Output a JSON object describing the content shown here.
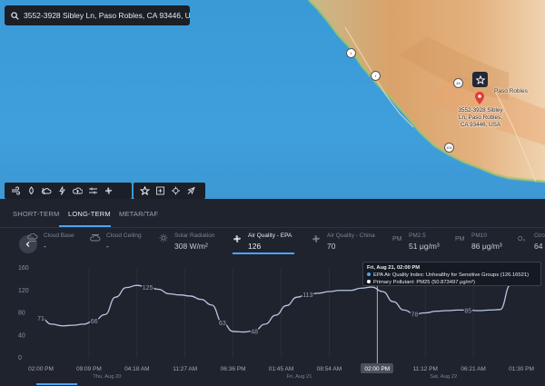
{
  "search": {
    "value": "3552-3928 Sibley Ln, Paso Robles, CA 93446, U"
  },
  "map": {
    "pin_label": "3552-3928 Sibley Ln, Paso Robles, CA 93446, USA",
    "pin_label_lines": [
      "3552-3928 Sibley",
      "Ln, Paso Robles,",
      "CA 93446, USA"
    ],
    "town_label": "Paso Robles",
    "highway_labels": [
      "1",
      "1",
      "46",
      "101"
    ]
  },
  "map_tools": {
    "group1": [
      "wind-icon",
      "rain-icon",
      "cloud-icon",
      "lightning-icon",
      "cloud-upload-icon",
      "sliders-icon",
      "fan-icon"
    ],
    "group2": [
      "star-icon",
      "plus-square-icon",
      "crosshair-icon",
      "plane-icon"
    ]
  },
  "tabs": [
    {
      "label": "SHORT-TERM",
      "active": false
    },
    {
      "label": "LONG-TERM",
      "active": true
    },
    {
      "label": "METAR/TAF",
      "active": false
    }
  ],
  "metrics": [
    {
      "name": "Cloud Base",
      "value": "-",
      "icon": "cloud-base-icon",
      "active": false
    },
    {
      "name": "Cloud Ceiling",
      "value": "-",
      "icon": "cloud-ceiling-icon",
      "active": false
    },
    {
      "name": "Solar Radiation",
      "value": "308 W/m²",
      "icon": "sun-icon",
      "active": false
    },
    {
      "name": "Air Quality - EPA",
      "value": "126",
      "icon": "fan-icon",
      "active": true
    },
    {
      "name": "Air Quality - China",
      "value": "70",
      "icon": "fan-icon",
      "active": false
    },
    {
      "name": "PM2.5",
      "value": "51 μg/m³",
      "icon": "pm25-icon",
      "active": false
    },
    {
      "name": "PM10",
      "value": "86 μg/m³",
      "icon": "pm10-icon",
      "active": false
    },
    {
      "name": "Ozo",
      "value": "64",
      "icon": "ozone-icon",
      "active": false
    }
  ],
  "tooltip": {
    "title": "Fri, Aug 21, 02:00 PM",
    "line1": "EPA Air Quality Index: Unhealthy for Sensitive Groups (126.16521)",
    "line2": "Primary Pollutant: PM25 (50.873497 μg/m³)",
    "line1_color": "#4da3ff",
    "line2_color": "#ffffff"
  },
  "colors": {
    "accent": "#4da3ff",
    "panel_bg": "#1e232e",
    "line": "#b9c6e4",
    "pin": "#e53935"
  },
  "chart_data": {
    "type": "line",
    "ylim": [
      0,
      160
    ],
    "yticks": [
      0,
      40,
      80,
      120,
      160
    ],
    "x_tick_labels": [
      "02:00 PM",
      "09:09 PM",
      "04:18 AM",
      "11:27 AM",
      "06:36 PM",
      "01:45 AM",
      "08:54 AM",
      "02:00 PM",
      "11:12 PM",
      "06:21 AM",
      "01:30 PM"
    ],
    "date_labels": [
      "Thu, Aug 20",
      "Fri, Aug 21",
      "Sat, Aug 22"
    ],
    "highlighted_tick": "02:00 PM",
    "series": [
      {
        "values": [
          71,
          60,
          57,
          58,
          60,
          66,
          77,
          108,
          125,
          129,
          126,
          122,
          114,
          112,
          110,
          104,
          94,
          63,
          47,
          46,
          48,
          60,
          76,
          93,
          108,
          113,
          115,
          118,
          120,
          120,
          124,
          126,
          118,
          100,
          85,
          78,
          80,
          83,
          84,
          85,
          85,
          84,
          85,
          86,
          130,
          150
        ]
      }
    ],
    "point_labels": [
      {
        "index": 0,
        "text": "71"
      },
      {
        "index": 5,
        "text": "66"
      },
      {
        "index": 10,
        "text": "125"
      },
      {
        "index": 17,
        "text": "63"
      },
      {
        "index": 20,
        "text": "48"
      },
      {
        "index": 25,
        "text": "113"
      },
      {
        "index": 35,
        "text": "78"
      },
      {
        "index": 40,
        "text": "85"
      }
    ],
    "cursor_index": 31
  }
}
